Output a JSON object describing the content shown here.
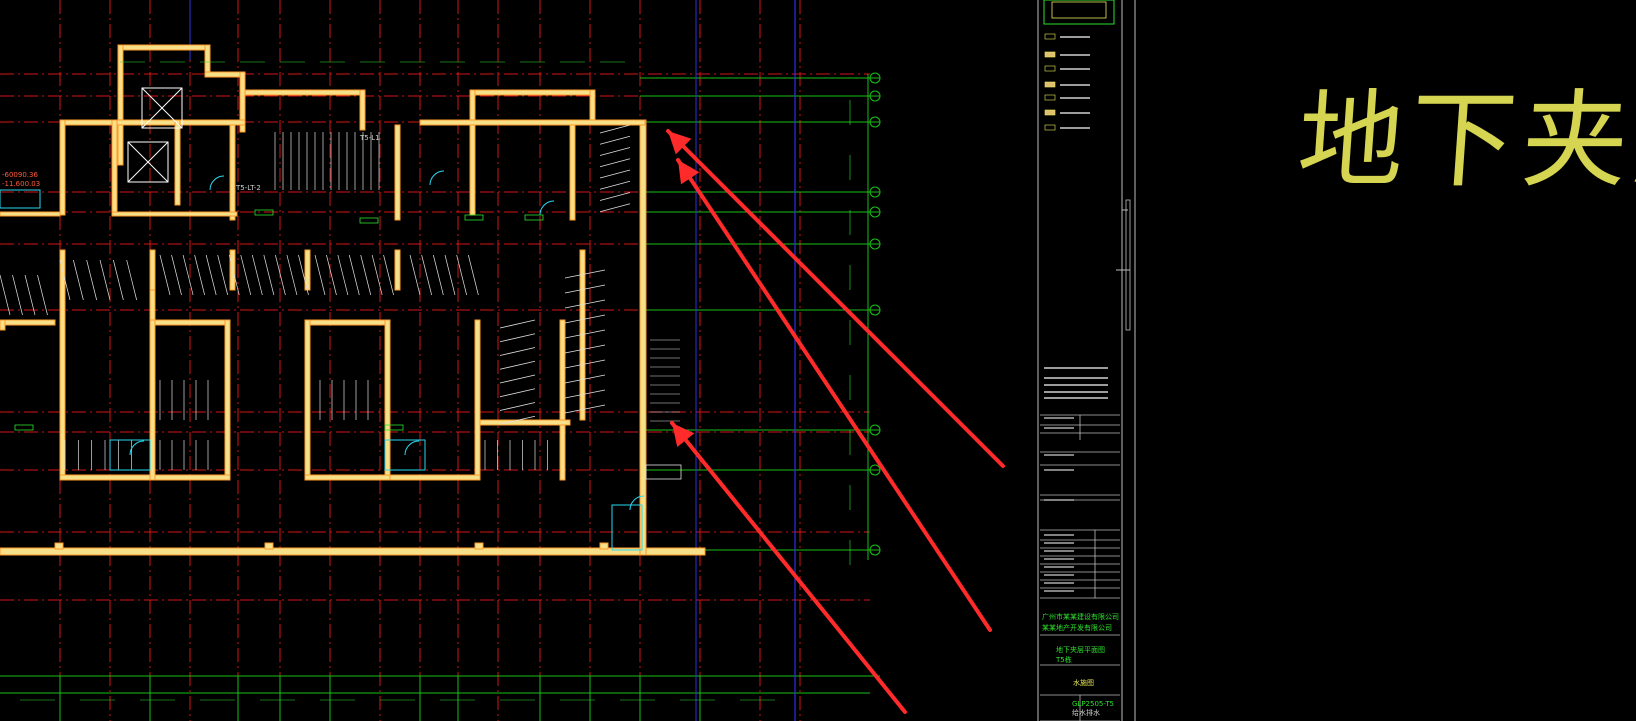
{
  "drawing": {
    "level_title": "地下夹层",
    "colors": {
      "background": "#000000",
      "wall_outline": "#ff9a2a",
      "wall_fill": "#f6e08a",
      "axis_red": "#d41414",
      "axis_green": "#18c018",
      "axis_blue": "#3030e0",
      "cyan": "#28d8f0",
      "annotation_arrow": "#ff2a2a",
      "title_text": "#e8e85a",
      "titleblock_line": "#bdbdbd"
    },
    "labels": {
      "elevator_tag": "T5-LT-2",
      "elevator_tag_2": "T5-L1",
      "elevation_1": "-60090.36",
      "elevation_2": "-11.600.03"
    }
  },
  "titleblock": {
    "project_line_1": "广州市某某建设有限公司",
    "project_line_2": "某某地产开发有限公司",
    "drawing_name_1": "地下夹层平面图",
    "drawing_name_2": "T5栋",
    "sheet_label": "水施图",
    "drawing_number": "GLP2505-T5",
    "sheet_name": "给水排水"
  }
}
